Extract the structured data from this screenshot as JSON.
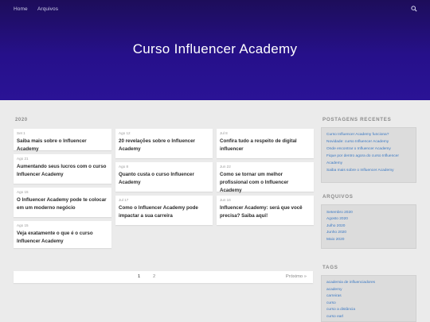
{
  "nav": {
    "home": "Home",
    "arquivos": "Arquivos",
    "search_icon": "search-icon"
  },
  "site": {
    "title": "Curso Influencer Academy"
  },
  "archive": {
    "year": "2020",
    "posts": [
      {
        "date": "Set 1",
        "title": "Saiba mais sobre o Influencer Academy"
      },
      {
        "date": "Ago 21",
        "title": "Aumentando seus lucros com o curso Influencer Academy"
      },
      {
        "date": "Ago 15",
        "title": "O Influencer Academy pode te colocar em um moderno negócio"
      },
      {
        "date": "Ago 15",
        "title": "Veja exatamente o que é o curso Influencer Academy"
      },
      {
        "date": "Ago 12",
        "title": "20 revelações sobre o Influencer Academy"
      },
      {
        "date": "Ago 8",
        "title": "Quanto custa o curso Influencer Academy"
      },
      {
        "date": "Jul 17",
        "title": "Como o Influencer Academy pode impactar a sua carreira"
      },
      {
        "date": "Jul 8",
        "title": "Confira tudo a respeito de digital influencer"
      },
      {
        "date": "Jun 22",
        "title": "Como se tornar um melhor profissional com o Influencer Academy"
      },
      {
        "date": "Jun 16",
        "title": "Influencer Academy: será que você precisa? Saiba aqui!"
      }
    ]
  },
  "pagination": {
    "page1": "1",
    "page2": "2",
    "next": "Próximo »"
  },
  "sidebar": {
    "recent_heading": "POSTAGENS RECENTES",
    "recent": [
      "Curso Influencer Academy funciona?",
      "Novidade: curso Influencer Academy",
      "Onde encontrar o Influencer Academy",
      "Fique por dentro agora do curso Influencer",
      "Academy",
      "Saiba mais sobre o Influencer Academy"
    ],
    "archives_heading": "ARQUIVOS",
    "archives": [
      "Setembro 2020",
      "Agosto 2020",
      "Julho 2020",
      "Junho 2020",
      "Maio 2020"
    ],
    "tags_heading": "TAGS",
    "tags": [
      "academia de influenciadores",
      "academy",
      "carreiras",
      "curso",
      "curso a distância",
      "curso earl"
    ]
  }
}
